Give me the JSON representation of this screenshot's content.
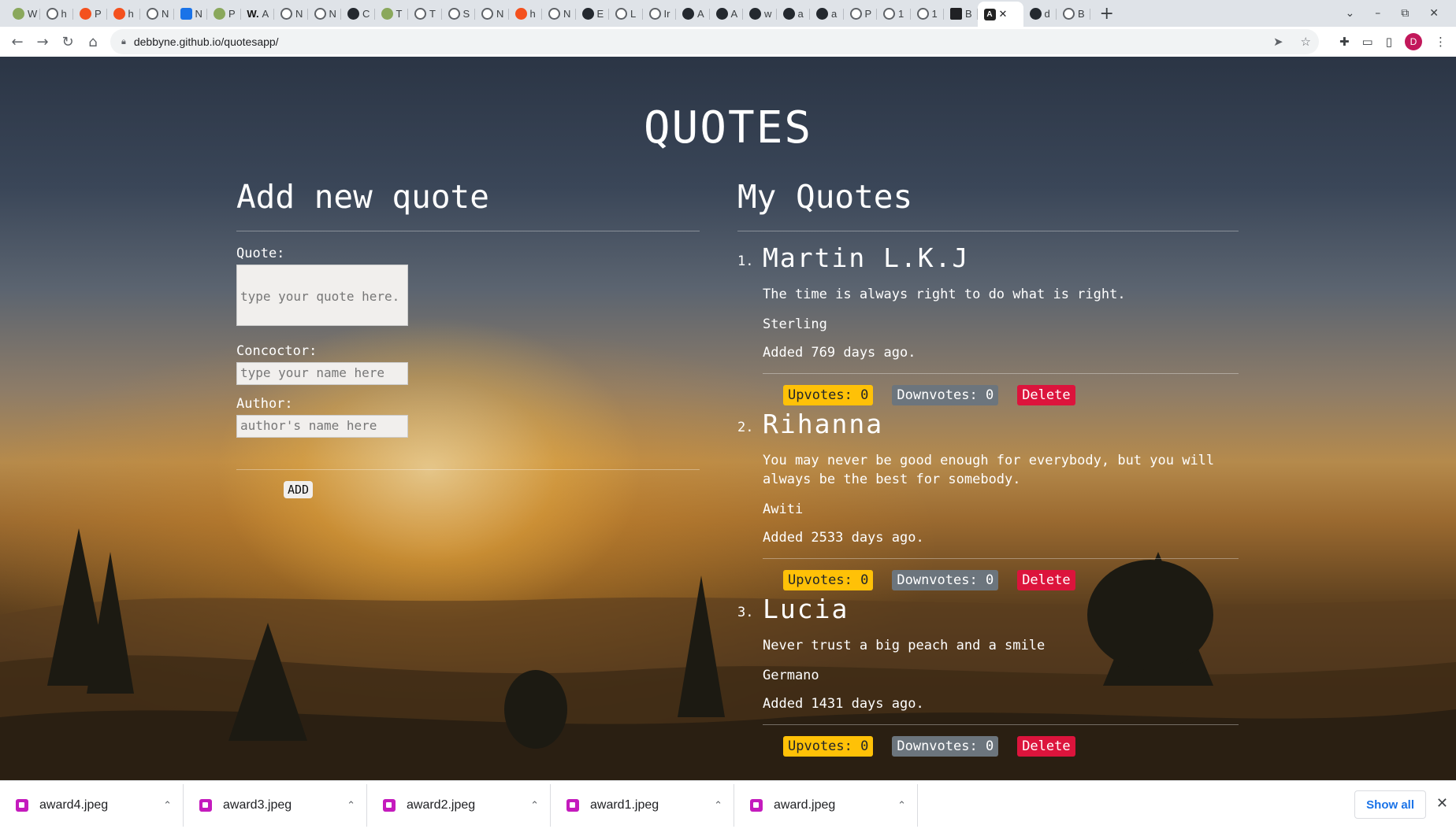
{
  "browser": {
    "tabs": [
      {
        "letter": "W",
        "icon": "plant-icon"
      },
      {
        "letter": "h",
        "icon": "globe-icon"
      },
      {
        "letter": "P",
        "icon": "orange-icon"
      },
      {
        "letter": "h",
        "icon": "orange-icon"
      },
      {
        "letter": "N",
        "icon": "globe-icon"
      },
      {
        "letter": "N",
        "icon": "calendar-icon"
      },
      {
        "letter": "P",
        "icon": "plant-icon"
      },
      {
        "letter": "A",
        "icon": "w-icon"
      },
      {
        "letter": "N",
        "icon": "globe-icon"
      },
      {
        "letter": "N",
        "icon": "globe-icon"
      },
      {
        "letter": "C",
        "icon": "github-icon"
      },
      {
        "letter": "T",
        "icon": "plant-icon"
      },
      {
        "letter": "T",
        "icon": "globe-icon"
      },
      {
        "letter": "S",
        "icon": "globe-icon"
      },
      {
        "letter": "N",
        "icon": "globe-icon"
      },
      {
        "letter": "h",
        "icon": "orange-icon"
      },
      {
        "letter": "N",
        "icon": "globe-icon"
      },
      {
        "letter": "E",
        "icon": "github-icon"
      },
      {
        "letter": "L",
        "icon": "globe-icon"
      },
      {
        "letter": "Ir",
        "icon": "globe-icon"
      },
      {
        "letter": "A",
        "icon": "github-icon"
      },
      {
        "letter": "A",
        "icon": "github-icon"
      },
      {
        "letter": "w",
        "icon": "github-icon"
      },
      {
        "letter": "a",
        "icon": "github-icon"
      },
      {
        "letter": "a",
        "icon": "github-icon"
      },
      {
        "letter": "P",
        "icon": "globe-icon"
      },
      {
        "letter": "1",
        "icon": "globe-icon"
      },
      {
        "letter": "1",
        "icon": "globe-icon"
      },
      {
        "letter": "B",
        "icon": "bag-icon"
      }
    ],
    "active_tab_icon": "angular-icon",
    "tabs_after": [
      {
        "letter": "d",
        "icon": "github-icon"
      },
      {
        "letter": "B",
        "icon": "globe-icon"
      }
    ],
    "url": "debbyne.github.io/quotesapp/",
    "avatar_letter": "D"
  },
  "app": {
    "title": "QUOTES",
    "form": {
      "heading": "Add new quote",
      "quote_label": "Quote:",
      "quote_placeholder": "type your quote here.",
      "concoctor_label": "Concoctor:",
      "concoctor_placeholder": "type your name here",
      "author_label": "Author:",
      "author_placeholder": "author's name here",
      "add_label": "ADD"
    },
    "list_heading": "My Quotes",
    "quotes": [
      {
        "num": "1.",
        "name": "Martin L.K.J",
        "text": "The time is always right to do what is right.",
        "concoctor": "Sterling",
        "added": "Added 769 days ago.",
        "upvotes": "Upvotes: 0",
        "downvotes": "Downvotes: 0",
        "delete": "Delete"
      },
      {
        "num": "2.",
        "name": "Rihanna",
        "text": "You may never be good enough for everybody, but you will always be the best for somebody.",
        "concoctor": "Awiti",
        "added": "Added 2533 days ago.",
        "upvotes": "Upvotes: 0",
        "downvotes": "Downvotes: 0",
        "delete": "Delete"
      },
      {
        "num": "3.",
        "name": "Lucia",
        "text": "Never trust a big peach and a smile",
        "concoctor": "Germano",
        "added": "Added 1431 days ago.",
        "upvotes": "Upvotes: 0",
        "downvotes": "Downvotes: 0",
        "delete": "Delete"
      }
    ]
  },
  "downloads": {
    "items": [
      "award4.jpeg",
      "award3.jpeg",
      "award2.jpeg",
      "award1.jpeg",
      "award.jpeg"
    ],
    "show_all": "Show all"
  }
}
